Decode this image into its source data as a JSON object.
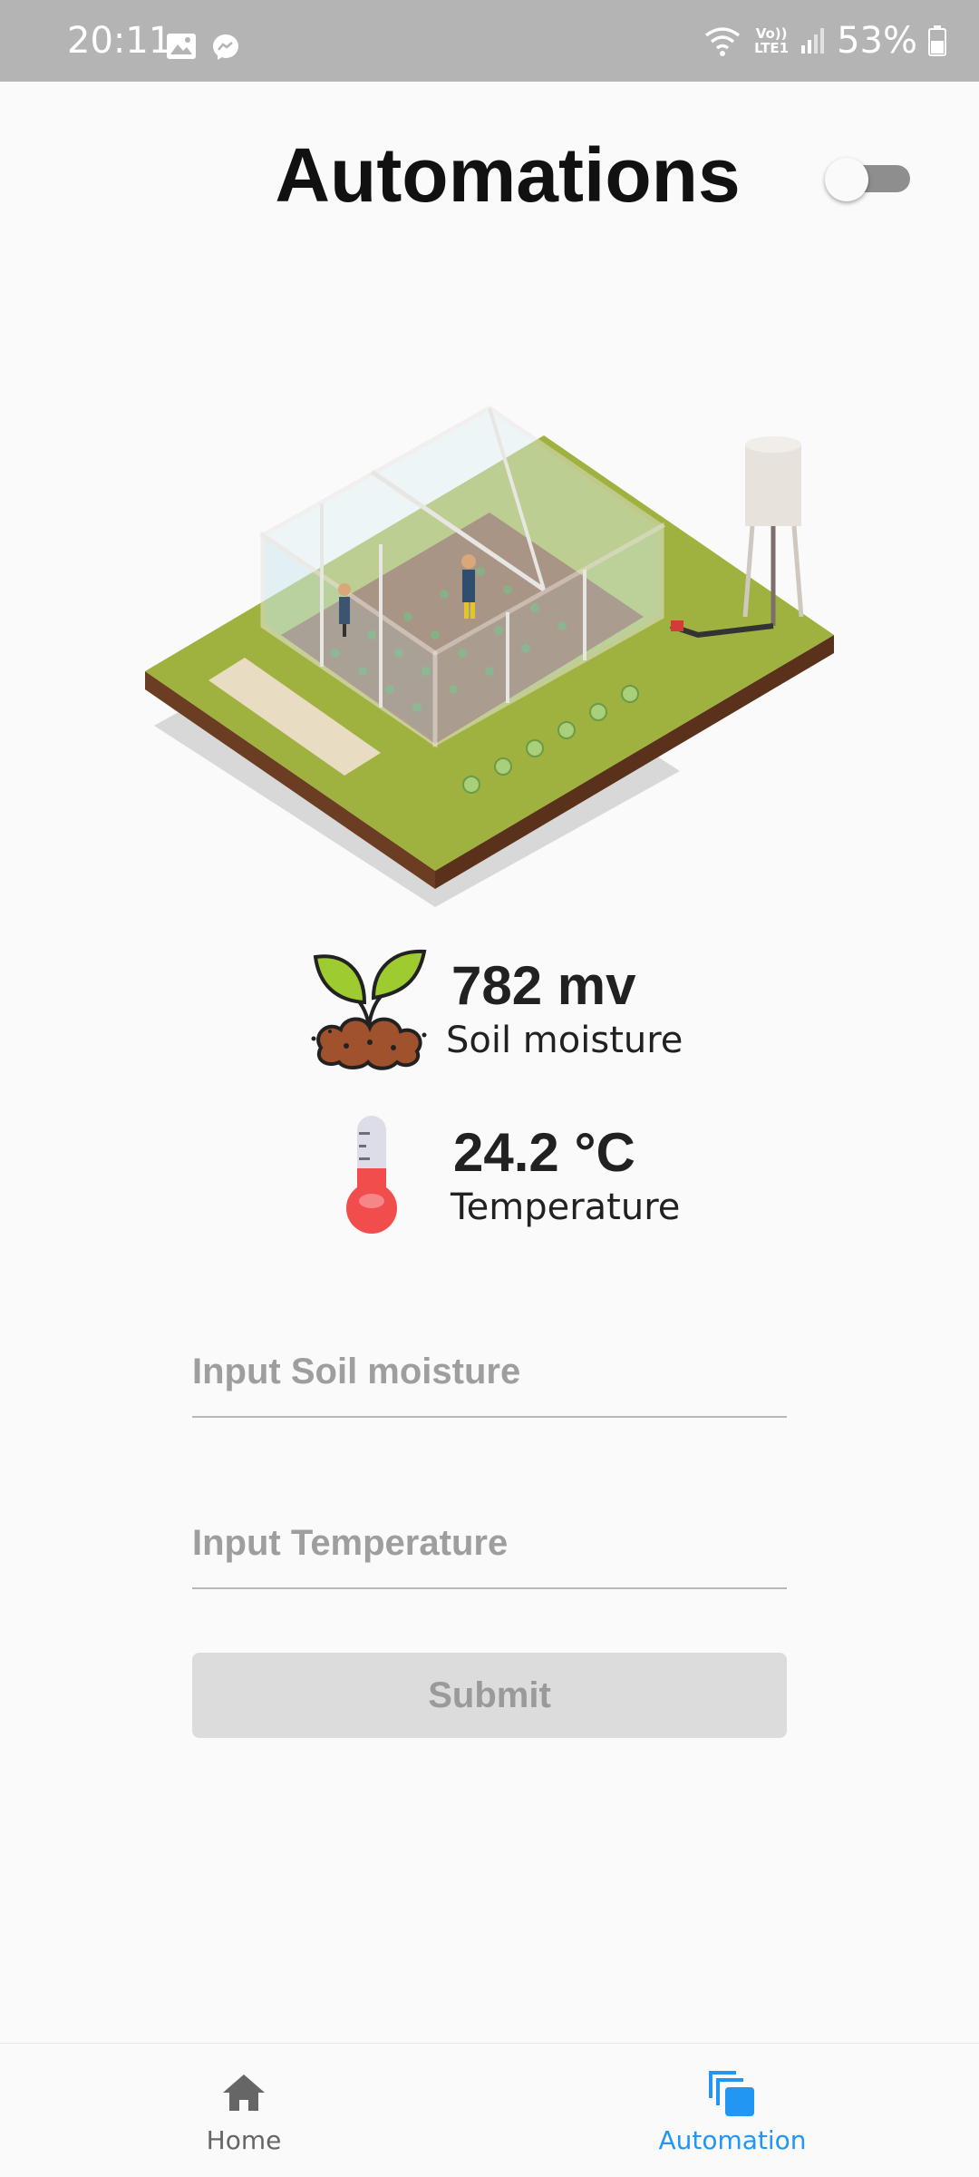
{
  "status_bar": {
    "time": "20:11",
    "network_label": "Vo)) LTE1",
    "battery_percent": "53%",
    "icons": [
      "image-icon",
      "messenger-icon",
      "wifi-icon",
      "signal-icon",
      "battery-icon"
    ]
  },
  "header": {
    "title": "Automations",
    "toggle_on": false
  },
  "illustration": {
    "icon": "greenhouse-illustration"
  },
  "soil": {
    "value": "782 mv",
    "label": "Soil moisture",
    "icon": "sprout-soil-icon"
  },
  "temperature": {
    "value": "24.2 °C",
    "label": "Temperature",
    "icon": "thermometer-icon"
  },
  "form": {
    "soil_placeholder": "Input Soil moisture",
    "temp_placeholder": "Input Temperature",
    "submit_label": "Submit"
  },
  "nav": {
    "items": [
      {
        "label": "Home",
        "icon": "home-icon",
        "active": false
      },
      {
        "label": "Automation",
        "icon": "automation-icon",
        "active": true
      }
    ],
    "active_color": "#2196f3",
    "inactive_color": "#666666"
  },
  "colors": {
    "status_bar": "#b4b4b4",
    "background": "#fafafa",
    "submit_disabled": "#dcdcdc"
  }
}
